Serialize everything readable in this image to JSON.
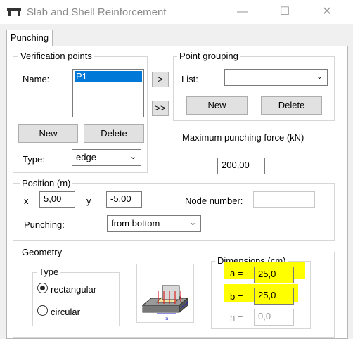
{
  "window": {
    "title": "Slab and Shell Reinforcement",
    "minimize_glyph": "—",
    "maximize_glyph": "☐",
    "close_glyph": "✕"
  },
  "tabs": [
    {
      "label": "Punching"
    }
  ],
  "verification_points": {
    "legend": "Verification points",
    "name_label": "Name:",
    "list_items": [
      "P1"
    ],
    "new_label": "New",
    "delete_label": "Delete",
    "type_label": "Type:",
    "type_value": "edge"
  },
  "transfer": {
    "single": ">",
    "all": ">>"
  },
  "point_grouping": {
    "legend": "Point grouping",
    "list_label": "List:",
    "list_value": "",
    "new_label": "New",
    "delete_label": "Delete"
  },
  "max_force": {
    "label": "Maximum punching force (kN)",
    "value": "200,00"
  },
  "position": {
    "legend": "Position (m)",
    "x_label": "x",
    "x_value": "5,00",
    "y_label": "y",
    "y_value": "-5,00",
    "node_label": "Node number:",
    "node_value": "",
    "punching_label": "Punching:",
    "punching_value": "from bottom"
  },
  "geometry": {
    "legend": "Geometry",
    "type_legend": "Type",
    "rect_label": "rectangular",
    "circ_label": "circular",
    "selected": "rectangular",
    "dim_legend": "Dimensions (cm)",
    "a_label": "a =",
    "a_value": "25,0",
    "b_label": "b =",
    "b_value": "25,0",
    "h_label": "h =",
    "h_value": "0,0",
    "highlight_color": "#ffff00"
  }
}
